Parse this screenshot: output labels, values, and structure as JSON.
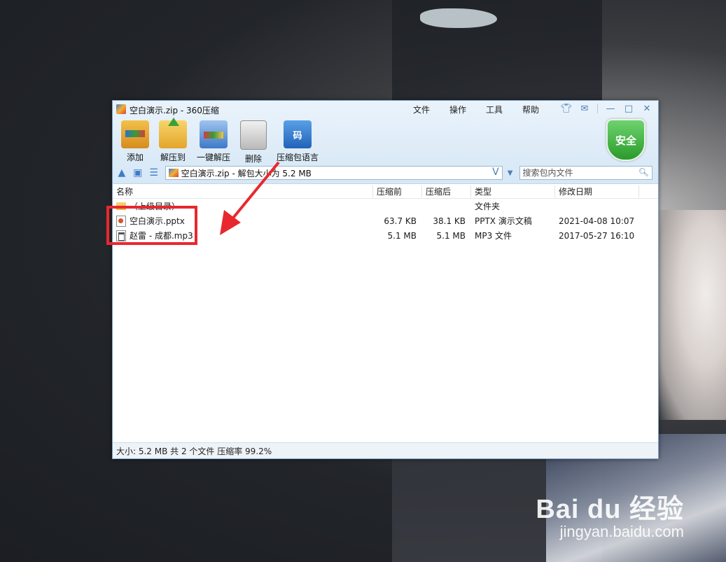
{
  "window": {
    "title": "空白演示.zip - 360压缩",
    "menu": [
      "文件",
      "操作",
      "工具",
      "帮助"
    ]
  },
  "toolbar": {
    "items": [
      {
        "label": "添加",
        "icon": "add-archive-icon"
      },
      {
        "label": "解压到",
        "icon": "extract-to-icon"
      },
      {
        "label": "一键解压",
        "icon": "one-click-extract-icon"
      },
      {
        "label": "删除",
        "icon": "trash-icon"
      },
      {
        "label": "压缩包语言",
        "icon": "archive-language-icon",
        "glyph": "码"
      }
    ],
    "security_badge": "安全"
  },
  "address": {
    "text": "空白演示.zip - 解包大小为 5.2 MB",
    "v_glyph": "V"
  },
  "search": {
    "placeholder": "搜索包内文件"
  },
  "columns": {
    "name": "名称",
    "before": "压缩前",
    "after": "压缩后",
    "type": "类型",
    "date": "修改日期"
  },
  "rows": [
    {
      "name": "（上级目录）",
      "before": "",
      "after": "",
      "type": "文件夹",
      "date": "",
      "icon": "folder-icon"
    },
    {
      "name": "空白演示.pptx",
      "before": "63.7 KB",
      "after": "38.1 KB",
      "type": "PPTX 演示文稿",
      "date": "2021-04-08 10:07",
      "icon": "pptx-file-icon"
    },
    {
      "name": "赵雷 - 成都.mp3",
      "before": "5.1 MB",
      "after": "5.1 MB",
      "type": "MP3 文件",
      "date": "2017-05-27 16:10",
      "icon": "mp3-file-icon"
    }
  ],
  "status": "大小: 5.2 MB 共 2 个文件 压缩率 99.2%",
  "watermark": {
    "brand": "Bai du 经验",
    "url": "jingyan.baidu.com"
  },
  "colors": {
    "highlight": "#e8282e",
    "accent": "#3c7cc8",
    "security": "#2a9a2a"
  }
}
